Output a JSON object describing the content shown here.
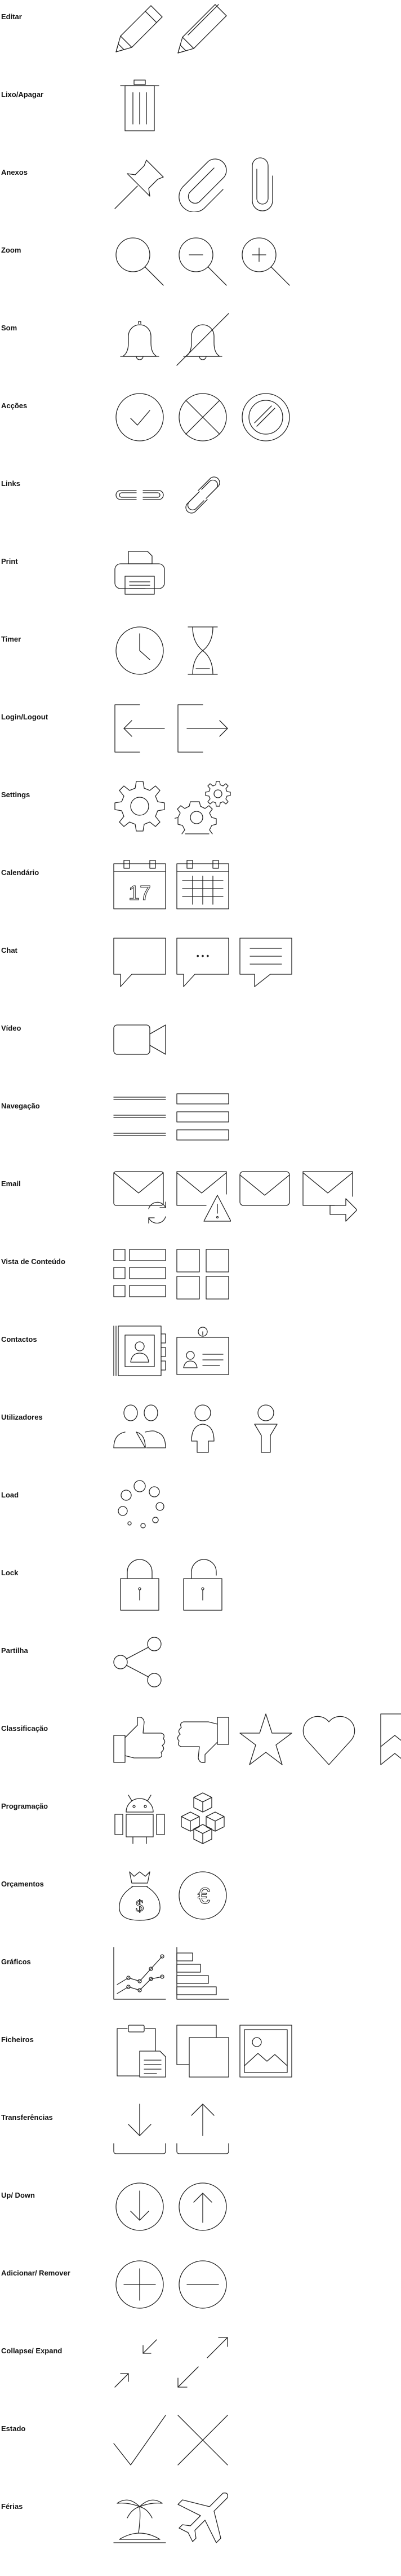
{
  "sections": [
    {
      "id": "editar",
      "label": "Editar",
      "icons": [
        "pencil-icon",
        "pencil-alt-icon"
      ]
    },
    {
      "id": "lixo",
      "label": "Lixo/Apagar",
      "icons": [
        "trash-icon"
      ]
    },
    {
      "id": "anexos",
      "label": "Anexos",
      "icons": [
        "pushpin-icon",
        "paperclip-diagonal-icon",
        "paperclip-vertical-icon"
      ]
    },
    {
      "id": "zoom",
      "label": "Zoom",
      "icons": [
        "magnifier-icon",
        "zoom-out-icon",
        "zoom-in-icon"
      ]
    },
    {
      "id": "som",
      "label": "Som",
      "icons": [
        "bell-icon",
        "bell-muted-icon"
      ]
    },
    {
      "id": "accoes",
      "label": "Acções",
      "icons": [
        "check-circle-icon",
        "x-circle-icon",
        "forbidden-circle-icon"
      ]
    },
    {
      "id": "links",
      "label": "Links",
      "icons": [
        "link-broken-icon",
        "link-icon"
      ]
    },
    {
      "id": "print",
      "label": "Print",
      "icons": [
        "printer-icon"
      ]
    },
    {
      "id": "timer",
      "label": "Timer",
      "icons": [
        "clock-icon",
        "hourglass-icon"
      ]
    },
    {
      "id": "login",
      "label": "Login/Logout",
      "icons": [
        "login-icon",
        "logout-icon"
      ]
    },
    {
      "id": "settings",
      "label": "Settings",
      "icons": [
        "gear-icon",
        "gears-icon"
      ]
    },
    {
      "id": "calendario",
      "label": "Calendário",
      "icons": [
        "calendar-day-icon",
        "calendar-grid-icon"
      ],
      "calendar_day": "17"
    },
    {
      "id": "chat",
      "label": "Chat",
      "icons": [
        "speech-bubble-icon",
        "speech-bubble-dots-icon",
        "speech-bubble-lines-icon"
      ],
      "dots": "• • •"
    },
    {
      "id": "video",
      "label": "Vídeo",
      "icons": [
        "video-camera-icon"
      ]
    },
    {
      "id": "navegacao",
      "label": "Navegação",
      "icons": [
        "menu-lines-icon",
        "menu-boxes-icon"
      ]
    },
    {
      "id": "email",
      "label": "Email",
      "icons": [
        "mail-sync-icon",
        "mail-warning-icon",
        "mail-icon",
        "mail-forward-icon"
      ]
    },
    {
      "id": "vista",
      "label": "Vista de Conteúdo",
      "icons": [
        "list-view-icon",
        "grid-view-icon"
      ]
    },
    {
      "id": "contactos",
      "label": "Contactos",
      "icons": [
        "address-book-icon",
        "id-card-icon"
      ]
    },
    {
      "id": "utilizadores",
      "label": "Utilizadores",
      "icons": [
        "users-icon",
        "user-icon",
        "user-alt-icon"
      ]
    },
    {
      "id": "load",
      "label": "Load",
      "icons": [
        "loading-dots-icon"
      ]
    },
    {
      "id": "lock",
      "label": "Lock",
      "icons": [
        "lock-closed-icon",
        "lock-open-icon"
      ]
    },
    {
      "id": "partilha",
      "label": "Partilha",
      "icons": [
        "share-icon"
      ]
    },
    {
      "id": "classificacao",
      "label": "Classificação",
      "icons": [
        "thumbs-up-icon",
        "thumbs-down-icon",
        "star-icon",
        "heart-icon",
        "bookmark-icon"
      ]
    },
    {
      "id": "programacao",
      "label": "Programação",
      "icons": [
        "android-icon",
        "cubes-icon"
      ]
    },
    {
      "id": "orcamentos",
      "label": "Orçamentos",
      "icons": [
        "money-bag-icon",
        "euro-coin-icon"
      ],
      "dollar": "$",
      "euro": "€"
    },
    {
      "id": "graficos",
      "label": "Gráficos",
      "icons": [
        "line-chart-icon",
        "bar-chart-icon"
      ]
    },
    {
      "id": "ficheiros",
      "label": "Ficheiros",
      "icons": [
        "clipboard-files-icon",
        "stacked-files-icon",
        "image-file-icon"
      ]
    },
    {
      "id": "transferencias",
      "label": "Transferências",
      "icons": [
        "download-tray-icon",
        "upload-tray-icon"
      ]
    },
    {
      "id": "updown",
      "label": "Up/ Down",
      "icons": [
        "arrow-down-circle-icon",
        "arrow-up-circle-icon"
      ]
    },
    {
      "id": "addremove",
      "label": "Adicionar/ Remover",
      "icons": [
        "plus-circle-icon",
        "minus-circle-icon"
      ]
    },
    {
      "id": "collapse",
      "label": "Collapse/ Expand",
      "icons": [
        "collapse-icon",
        "expand-icon"
      ]
    },
    {
      "id": "estado",
      "label": "Estado",
      "icons": [
        "checkmark-icon",
        "cross-icon"
      ]
    },
    {
      "id": "ferias",
      "label": "Férias",
      "icons": [
        "island-icon",
        "airplane-icon"
      ]
    }
  ]
}
